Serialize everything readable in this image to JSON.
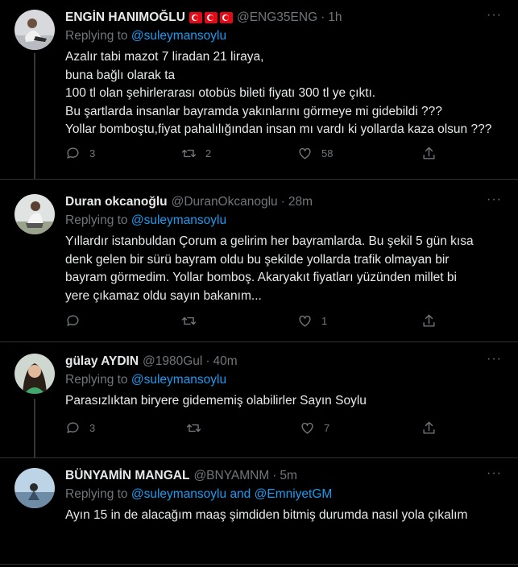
{
  "reply_prefix": "Replying to",
  "tweets": [
    {
      "name": "ENGİN HANIMOĞLU",
      "handle": "@ENG35ENG",
      "time": "1h",
      "reply_to": "@suleymansoylu",
      "lines": [
        "Azalır tabi mazot 7 liradan 21 liraya,",
        "buna bağlı olarak ta",
        "100 tl olan şehirlerarası otobüs bileti fiyatı 300 tl ye çıktı.",
        "Bu şartlarda insanlar bayramda yakınlarını görmeye mi gidebildi ???",
        "Yollar bomboştu,fiyat pahalılığından insan mı vardı ki yollarda kaza olsun ???"
      ],
      "replies": "3",
      "retweets": "2",
      "likes": "58"
    },
    {
      "name": "Duran okcanoğlu",
      "handle": "@DuranOkcanoglu",
      "time": "28m",
      "reply_to": "@suleymansoylu",
      "lines": [
        "Yıllardır istanbuldan Çorum a gelirim her bayramlarda.  Bu şekil 5 gün kısa",
        "denk gelen bir sürü bayram oldu bu şekilde yollarda trafik olmayan bir",
        "bayram görmedim.  Yollar bomboş. Akaryakıt fiyatları yüzünden millet bi",
        "yere çıkamaz oldu sayın bakanım..."
      ],
      "replies": "",
      "retweets": "",
      "likes": "1"
    },
    {
      "name": "gülay AYDIN",
      "handle": "@1980Gul",
      "time": "40m",
      "reply_to": "@suleymansoylu",
      "lines": [
        "Parasızlıktan biryere gidememiş olabilirler Sayın Soylu"
      ],
      "replies": "3",
      "retweets": "",
      "likes": "7"
    },
    {
      "name": "BÜNYAMİN MANGAL",
      "handle": "@BNYAMNM",
      "time": "5m",
      "reply_to": "@suleymansoylu",
      "reply_and": "and",
      "reply_to_2": "@EmniyetGM",
      "lines": [
        "Ayın 15 in de alacağım maaş şimdiden bitmiş durumda nasıl yola çıkalım"
      ]
    }
  ],
  "colors": {
    "background": "#000000",
    "mention": "#1d9bf0",
    "muted": "#71767b",
    "separator": "#2f3336"
  },
  "icons": [
    "reply-icon",
    "retweet-icon",
    "like-icon",
    "share-icon",
    "more-icon",
    "turkish-flag-icon"
  ]
}
